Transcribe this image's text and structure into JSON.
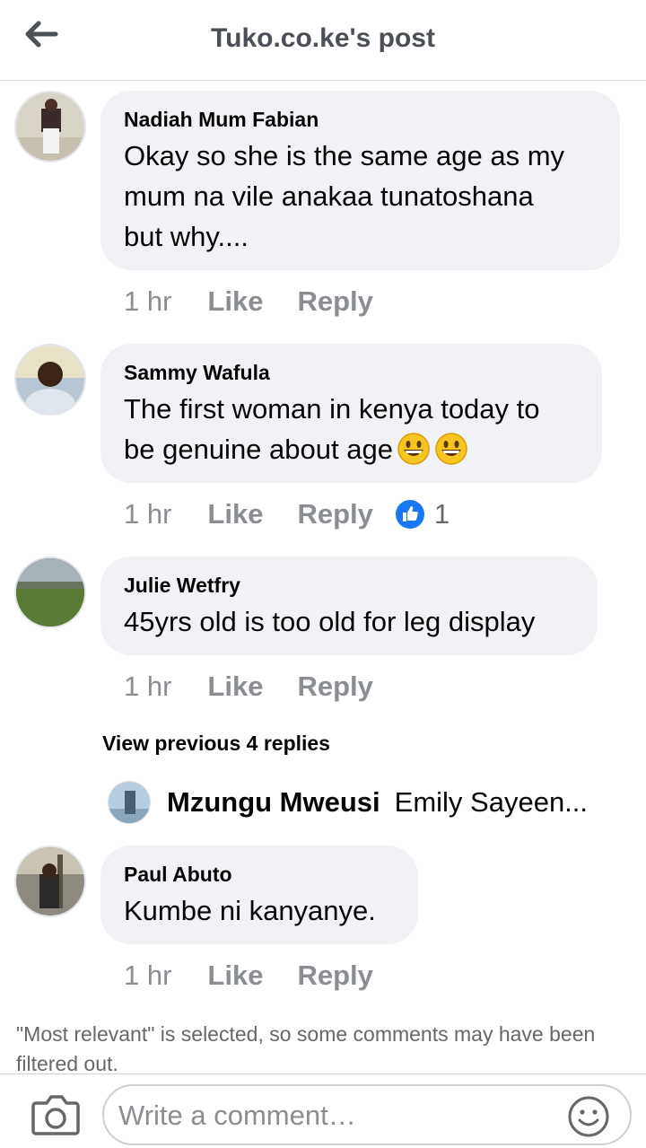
{
  "header": {
    "title": "Tuko.co.ke's post",
    "back_icon": "arrow-left-icon"
  },
  "comments": [
    {
      "author": "Nadiah Mum Fabian",
      "text_lines": [
        "Okay so she is the same age as my",
        "mum na vile anakaa tunatoshana",
        "but why...."
      ],
      "time": "1 hr",
      "like": "Like",
      "reply": "Reply"
    },
    {
      "author": "Sammy Wafula",
      "text_lines": [
        "The first woman in kenya today to",
        "be genuine about age"
      ],
      "emojis": [
        "grinning-face-icon",
        "grinning-face-icon"
      ],
      "time": "1 hr",
      "like": "Like",
      "reply": "Reply",
      "reaction": {
        "icon": "like-reaction-icon",
        "count": "1"
      }
    },
    {
      "author": "Julie Wetfry",
      "text_lines": [
        "45yrs old is too old for leg display"
      ],
      "time": "1 hr",
      "like": "Like",
      "reply": "Reply"
    },
    {
      "author": "Paul Abuto",
      "text_lines": [
        "Kumbe ni kanyanye."
      ],
      "time": "1 hr",
      "like": "Like",
      "reply": "Reply"
    }
  ],
  "view_previous": "View previous 4 replies",
  "reply_preview": {
    "author": "Mzungu Mweusi",
    "text": "Emily Sayeen..."
  },
  "filter_note": "\"Most relevant\" is selected, so some comments may have been filtered out.",
  "footer": {
    "placeholder": "Write a comment…",
    "camera_icon": "camera-icon",
    "emoji_icon": "smiley-icon"
  },
  "colors": {
    "bubble": "#f0f2f5",
    "meta_text": "#8a8d91",
    "like_blue": "#1877f2"
  }
}
